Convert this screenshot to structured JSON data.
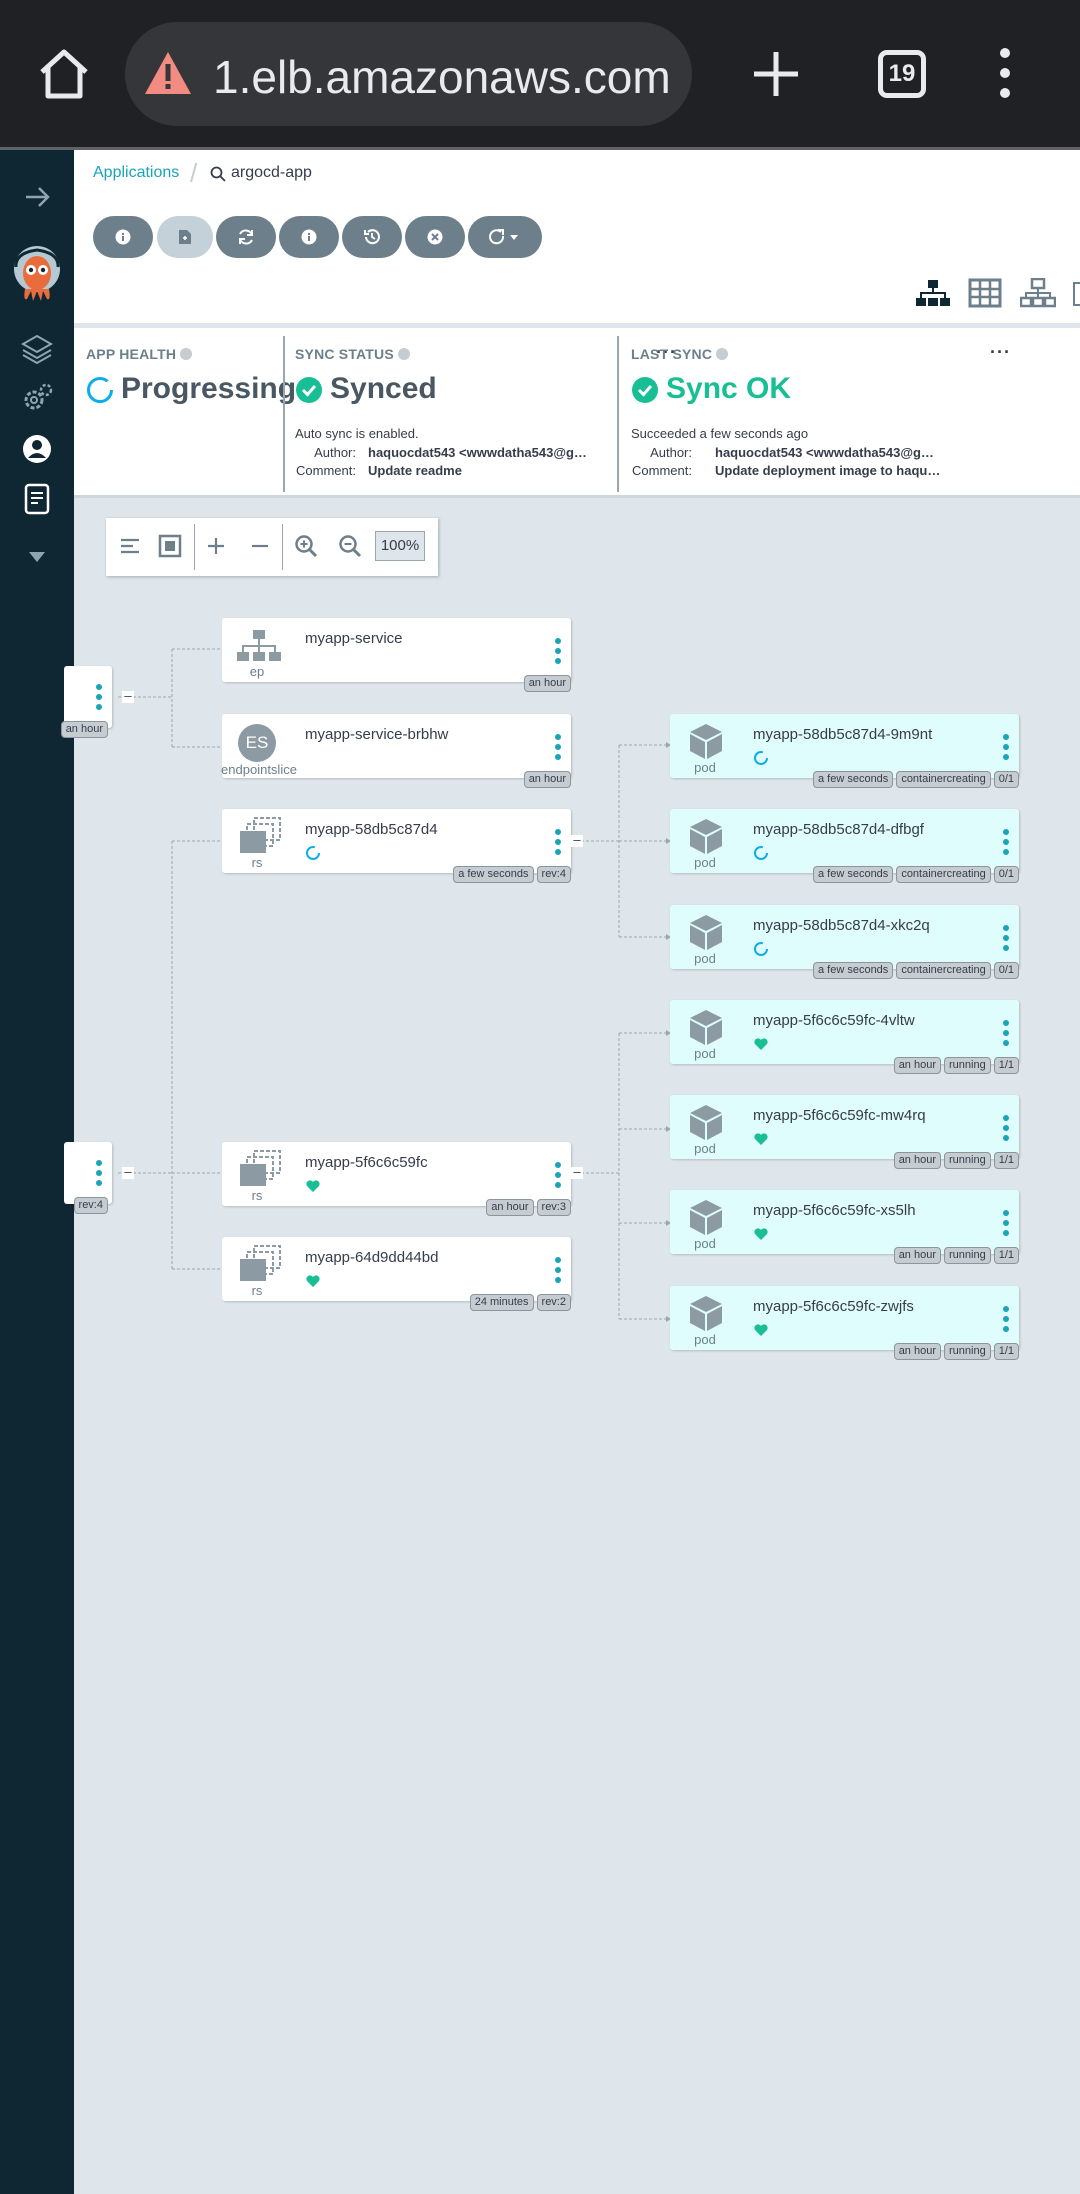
{
  "browser": {
    "url": "1.elb.amazonaws.com",
    "tab_count": "19"
  },
  "breadcrumb": {
    "applications_label": "Applications",
    "current_app": "argocd-app"
  },
  "status": {
    "app_health": {
      "label": "APP HEALTH",
      "value": "Progressing"
    },
    "sync_status": {
      "label": "SYNC STATUS",
      "value": "Synced",
      "auto_sync_text": "Auto sync is enabled.",
      "author_key": "Author:",
      "author": "haquocdat543 <wwwdatha543@g…",
      "comment_key": "Comment:",
      "comment": "Update readme"
    },
    "last_sync": {
      "label": "LAST SYNC",
      "value": "Sync OK",
      "succeeded_text": "Succeeded a few seconds ago",
      "author_key": "Author:",
      "author": "haquocdat543 <wwwdatha543@g…",
      "comment_key": "Comment:",
      "comment": "Update deployment image to haqu…"
    },
    "more_label": "···"
  },
  "zoom": {
    "level": "100%"
  },
  "nodes": {
    "svc_parent": {
      "tag_age": "an hour",
      "collapse": "–"
    },
    "deploy_parent": {
      "tag_rev": "rev:4",
      "collapse": "–"
    },
    "ep": {
      "name": "myapp-service",
      "kind": "ep",
      "tag_age": "an hour"
    },
    "es": {
      "name": "myapp-service-brbhw",
      "kind": "endpointslice",
      "badge": "ES",
      "tag_age": "an hour"
    },
    "rs1": {
      "name": "myapp-58db5c87d4",
      "kind": "rs",
      "tag_age": "a few seconds",
      "tag_rev": "rev:4",
      "collapse": "–"
    },
    "rs2": {
      "name": "myapp-5f6c6c59fc",
      "kind": "rs",
      "tag_age": "an hour",
      "tag_rev": "rev:3",
      "collapse": "–"
    },
    "rs3": {
      "name": "myapp-64d9dd44bd",
      "kind": "rs",
      "tag_age": "24 minutes",
      "tag_rev": "rev:2"
    },
    "pods": [
      {
        "name": "myapp-58db5c87d4-9m9nt",
        "kind": "pod",
        "status": "progressing",
        "tags": [
          "a few seconds",
          "containercreating",
          "0/1"
        ]
      },
      {
        "name": "myapp-58db5c87d4-dfbgf",
        "kind": "pod",
        "status": "progressing",
        "tags": [
          "a few seconds",
          "containercreating",
          "0/1"
        ]
      },
      {
        "name": "myapp-58db5c87d4-xkc2q",
        "kind": "pod",
        "status": "progressing",
        "tags": [
          "a few seconds",
          "containercreating",
          "0/1"
        ]
      },
      {
        "name": "myapp-5f6c6c59fc-4vltw",
        "kind": "pod",
        "status": "healthy",
        "tags": [
          "an hour",
          "running",
          "1/1"
        ]
      },
      {
        "name": "myapp-5f6c6c59fc-mw4rq",
        "kind": "pod",
        "status": "healthy",
        "tags": [
          "an hour",
          "running",
          "1/1"
        ]
      },
      {
        "name": "myapp-5f6c6c59fc-xs5lh",
        "kind": "pod",
        "status": "healthy",
        "tags": [
          "an hour",
          "running",
          "1/1"
        ]
      },
      {
        "name": "myapp-5f6c6c59fc-zwjfs",
        "kind": "pod",
        "status": "healthy",
        "tags": [
          "an hour",
          "running",
          "1/1"
        ]
      }
    ]
  },
  "colors": {
    "accent": "#1aa4ba",
    "healthy": "#18be94",
    "nav_bg": "#0f2733",
    "pod_bg": "#e0fdfe"
  }
}
